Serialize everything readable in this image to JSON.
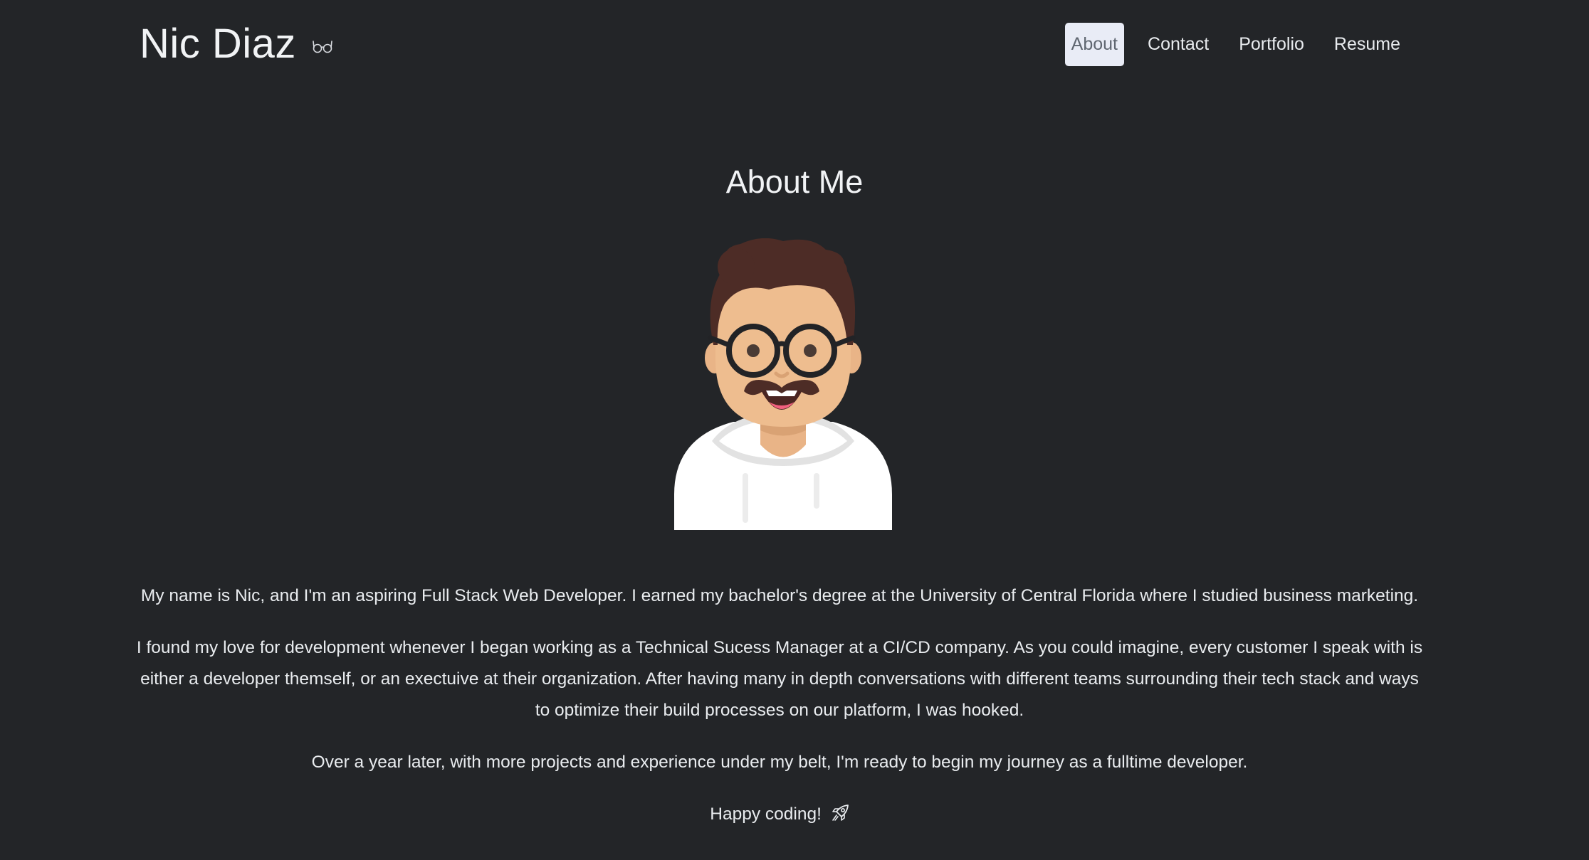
{
  "header": {
    "brand_name": "Nic Diaz",
    "brand_icon": "glasses-icon"
  },
  "nav": {
    "items": [
      {
        "label": "About",
        "active": true
      },
      {
        "label": "Contact",
        "active": false
      },
      {
        "label": "Portfolio",
        "active": false
      },
      {
        "label": "Resume",
        "active": false
      }
    ]
  },
  "main": {
    "title": "About Me",
    "avatar": "cartoon-developer-avatar",
    "paragraphs": [
      "My name is Nic, and I'm an aspiring Full Stack Web Developer. I earned my bachelor's degree at the University of Central Florida where I studied business marketing.",
      "I found my love for development whenever I began working as a Technical Sucess Manager at a CI/CD company. As you could imagine, every customer I speak with is either a developer themself, or an exectuive at their organization. After having many in depth conversations with different teams surrounding their tech stack and ways to optimize their build processes on our platform, I was hooked.",
      "Over a year later, with more projects and experience under my belt, I'm ready to begin my journey as a fulltime developer."
    ],
    "signoff": "Happy coding!",
    "signoff_icon": "rocket-icon"
  },
  "colors": {
    "background": "#232528",
    "text": "#e9ecef",
    "active_nav_bg": "#e9ecf6",
    "active_nav_text": "#5f6670"
  }
}
